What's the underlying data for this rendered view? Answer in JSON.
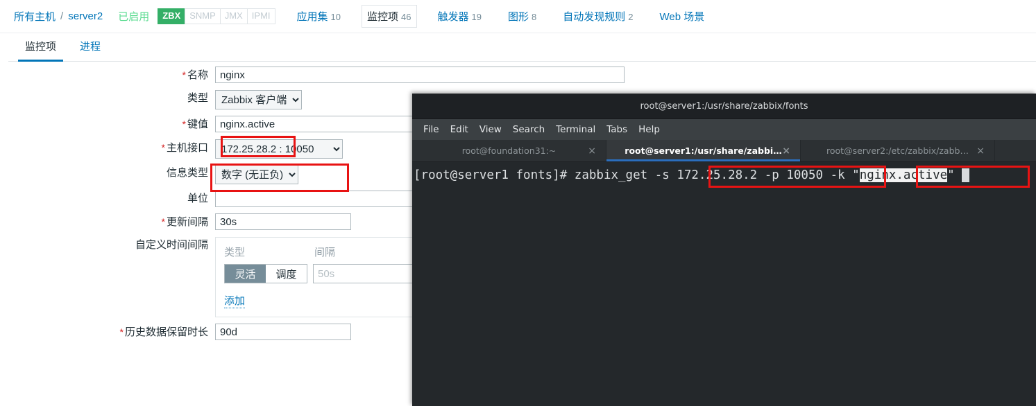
{
  "header": {
    "breadcrumb": {
      "root": "所有主机",
      "separator": "/",
      "host": "server2"
    },
    "status": "已启用",
    "protocols": [
      {
        "label": "ZBX",
        "enabled": true
      },
      {
        "label": "SNMP",
        "enabled": false
      },
      {
        "label": "JMX",
        "enabled": false
      },
      {
        "label": "IPMI",
        "enabled": false
      }
    ],
    "nav": [
      {
        "label": "应用集",
        "count": "10",
        "selected": false
      },
      {
        "label": "监控项",
        "count": "46",
        "selected": true
      },
      {
        "label": "触发器",
        "count": "19",
        "selected": false
      },
      {
        "label": "图形",
        "count": "8",
        "selected": false
      },
      {
        "label": "自动发现规则",
        "count": "2",
        "selected": false
      },
      {
        "label": "Web 场景",
        "count": "",
        "selected": false
      }
    ]
  },
  "form_tabs": [
    {
      "label": "监控项",
      "active": true
    },
    {
      "label": "进程",
      "active": false
    }
  ],
  "form": {
    "name": {
      "label": "名称",
      "required": true,
      "value": "nginx"
    },
    "type": {
      "label": "类型",
      "required": false,
      "value": "Zabbix 客户端"
    },
    "key": {
      "label": "键值",
      "required": true,
      "value": "nginx.active"
    },
    "host_interface": {
      "label": "主机接口",
      "required": true,
      "value": "172.25.28.2 : 10050"
    },
    "info_type": {
      "label": "信息类型",
      "required": false,
      "value": "数字 (无正负)"
    },
    "units": {
      "label": "单位",
      "required": false,
      "value": "",
      "placeholder": ""
    },
    "update_interval": {
      "label": "更新间隔",
      "required": true,
      "value": "30s"
    },
    "custom_intervals": {
      "label": "自定义时间间隔",
      "col_type": "类型",
      "col_interval": "间隔",
      "toggle_flexible": "灵活",
      "toggle_scheduling": "调度",
      "toggle_selected": "灵活",
      "interval_value": "",
      "interval_placeholder": "50s",
      "add_link": "添加"
    },
    "history": {
      "label": "历史数据保留时长",
      "required": true,
      "value": "90d"
    }
  },
  "terminal": {
    "title": "root@server1:/usr/share/zabbix/fonts",
    "menu": [
      "File",
      "Edit",
      "View",
      "Search",
      "Terminal",
      "Tabs",
      "Help"
    ],
    "tabs": [
      {
        "label": "root@foundation31:~",
        "active": false,
        "close": "×"
      },
      {
        "label": "root@server1:/usr/share/zabbi…",
        "active": true,
        "close": "×"
      },
      {
        "label": "root@server2:/etc/zabbix/zabb…",
        "active": false,
        "close": "×"
      }
    ],
    "command": {
      "prompt": "[root@server1 fonts]# ",
      "part_a": "zabbix_get -s ",
      "part_host": "172.25.28.2 -p 10050",
      "part_b": " -k \"",
      "part_key": "nginx.active",
      "part_c": "\" "
    }
  },
  "annotations": {
    "accent_red": "#e81313",
    "boxes": [
      {
        "name": "key-value-highlight"
      },
      {
        "name": "host-interface-highlight"
      },
      {
        "name": "terminal-host-highlight"
      },
      {
        "name": "terminal-key-highlight"
      }
    ]
  }
}
